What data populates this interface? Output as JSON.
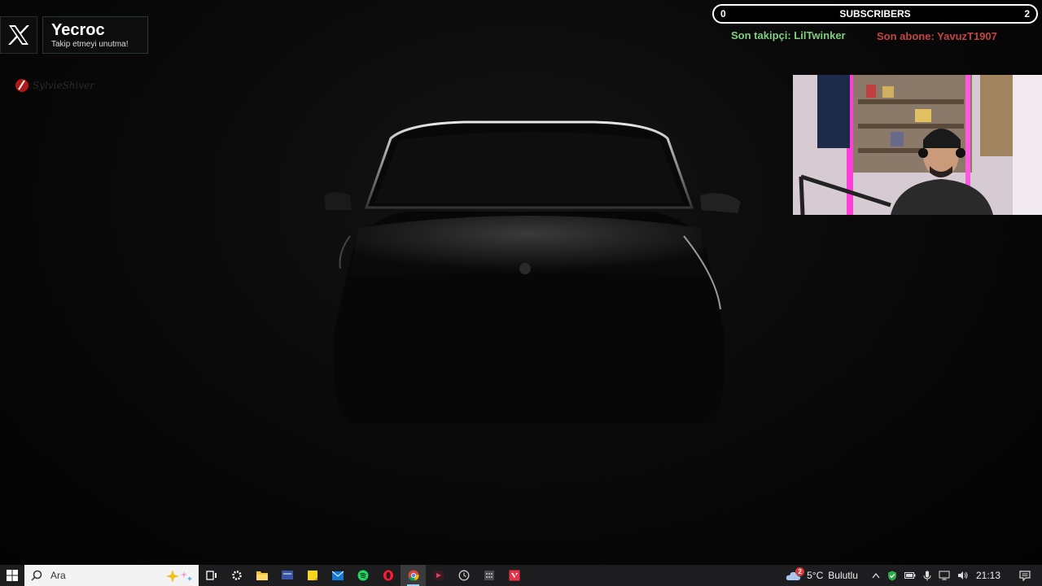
{
  "social": {
    "name": "Yecroc",
    "tagline": "Takip etmeyi unutma!",
    "icon": "x-logo-icon"
  },
  "sponsor": {
    "text": "SylvieShiver"
  },
  "subscribers": {
    "current": "0",
    "title": "SUBSCRIBERS",
    "goal": "2"
  },
  "alerts": {
    "last_follower": "Son takipçi: LilTwinker",
    "last_subscriber": "Son abone: YavuzT1907",
    "follower_color": "#7fd07f",
    "subscriber_color": "#c44545"
  },
  "taskbar": {
    "search_placeholder": "Ara",
    "apps": [
      "task-view-icon",
      "settings-icon",
      "file-explorer-icon",
      "display-app-icon",
      "sticky-notes-icon",
      "mail-icon",
      "spotify-icon",
      "opera-icon",
      "chrome-icon",
      "media-player-icon",
      "clock-app-icon",
      "calculator-icon",
      "valorant-icon"
    ],
    "active_app": "chrome-icon"
  },
  "tray": {
    "weather_badge": "2",
    "temperature": "5°C",
    "condition": "Bulutlu",
    "time": "21:13"
  }
}
